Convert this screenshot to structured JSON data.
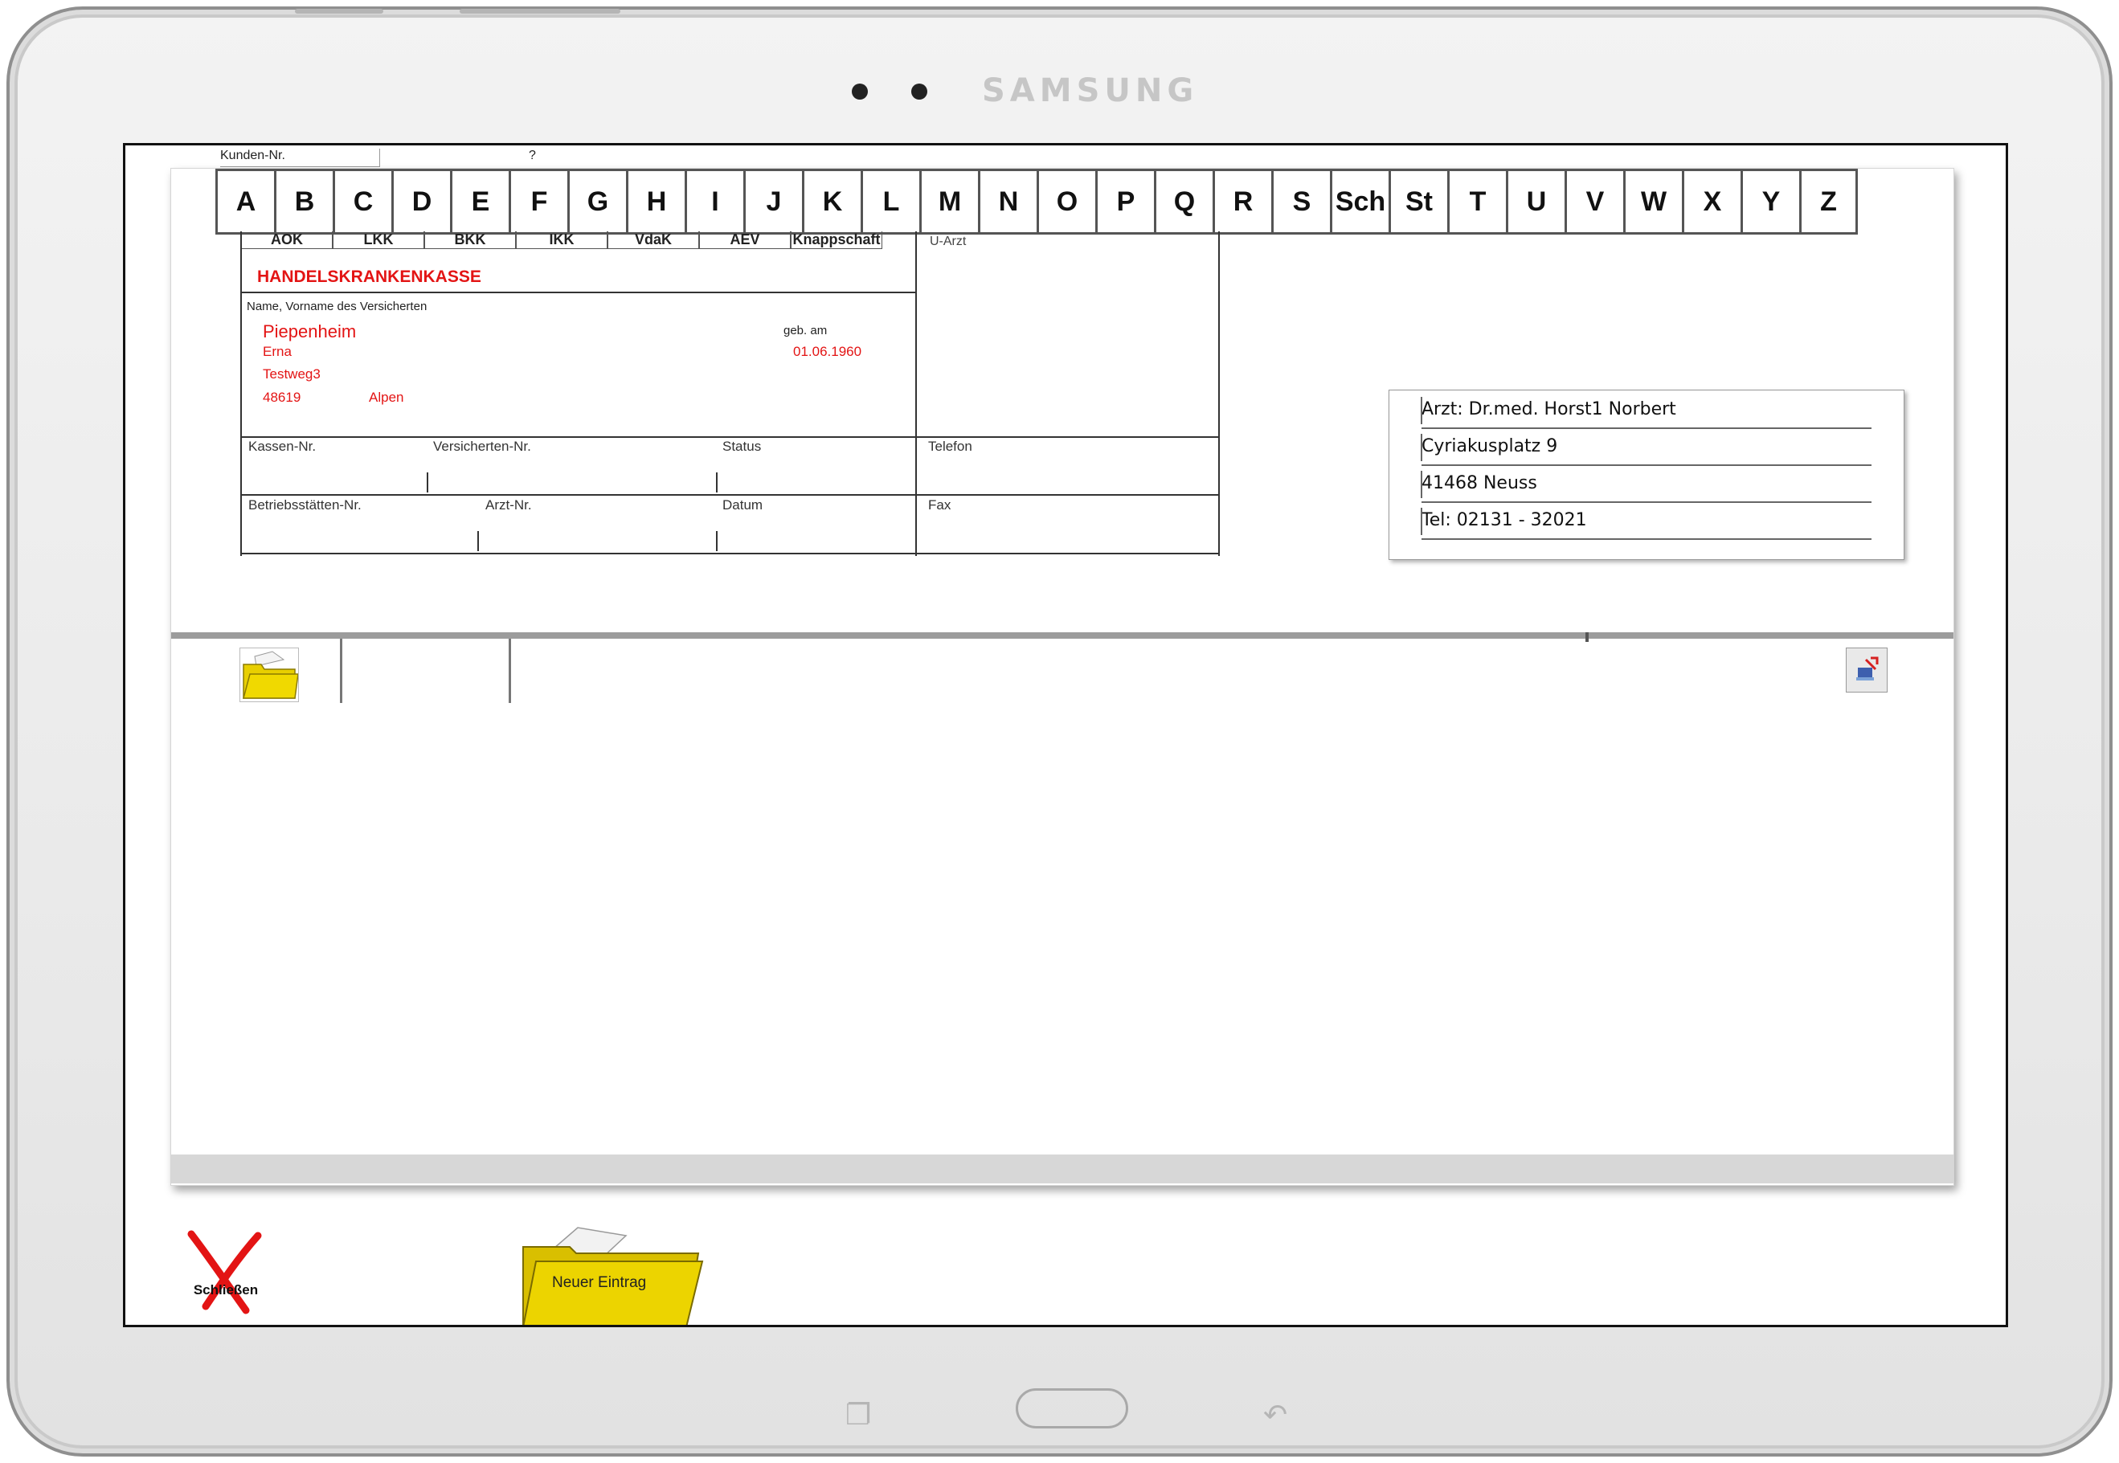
{
  "device": {
    "brand": "SAMSUNG"
  },
  "header": {
    "kunden_label": "Kunden-Nr.",
    "kunden_value": "?"
  },
  "alphabet": [
    "A",
    "B",
    "C",
    "D",
    "E",
    "F",
    "G",
    "H",
    "I",
    "J",
    "K",
    "L",
    "M",
    "N",
    "O",
    "P",
    "Q",
    "R",
    "S",
    "Sch",
    "St",
    "T",
    "U",
    "V",
    "W",
    "X",
    "Y",
    "Z"
  ],
  "kassen_tabs": [
    "AOK",
    "LKK",
    "BKK",
    "IKK",
    "VdaK",
    "AEV",
    "Knappschaft"
  ],
  "card": {
    "u_arzt_label": "U-Arzt",
    "kasse": "HANDELSKRANKENKASSE",
    "name_label": "Name, Vorname des Versicherten",
    "geb_label": "geb. am",
    "lastname": "Piepenheim",
    "firstname": "Erna",
    "street": "Testweg3",
    "zip": "48619",
    "city": "Alpen",
    "dob": "01.06.1960",
    "kassen_nr_label": "Kassen-Nr.",
    "versicherten_nr_label": "Versicherten-Nr.",
    "status_label": "Status",
    "telefon_label": "Telefon",
    "betriebsstaetten_nr_label": "Betriebsstätten-Nr.",
    "arzt_nr_label": "Arzt-Nr.",
    "datum_label": "Datum",
    "fax_label": "Fax"
  },
  "doctor": {
    "name": "Arzt: Dr.med. Horst1 Norbert",
    "street": "Cyriakusplatz 9",
    "city": "41468 Neuss",
    "phone": "Tel: 02131 - 32021"
  },
  "actions": {
    "close_label": "Schließen",
    "new_entry_label": "Neuer Eintrag"
  },
  "colors": {
    "accent_red": "#e31414",
    "folder_yellow": "#e8cf00"
  }
}
